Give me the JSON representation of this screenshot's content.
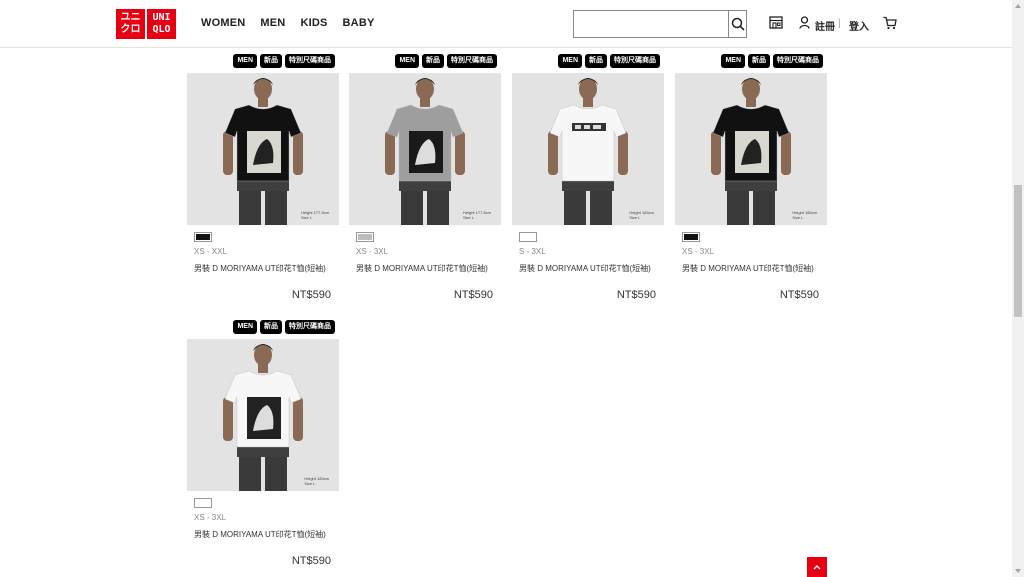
{
  "header": {
    "logo_lines": [
      "ユニ",
      "クロ"
    ],
    "logo_lines_right": [
      "UNI",
      "QLO"
    ],
    "nav": [
      "WOMEN",
      "MEN",
      "KIDS",
      "BABY"
    ],
    "search_value": "",
    "search_placeholder": "",
    "register_label": "註冊",
    "login_label": "登入",
    "separator": "|"
  },
  "products": [
    {
      "badges": [
        "MEN",
        "新品",
        "特別尺碼商品"
      ],
      "shirt_color": "#111111",
      "swatch_color": "#111111",
      "sizes": "XS - XXL",
      "name": "男裝 D MORIYAMA UT印花T恤(短袖)",
      "price": "NT$590",
      "caption": [
        "Height 177.5cm",
        "Size L"
      ],
      "view": "front"
    },
    {
      "badges": [
        "MEN",
        "新品",
        "特別尺碼商品"
      ],
      "shirt_color": "#9e9e9e",
      "swatch_color": "#bdbdbd",
      "sizes": "XS - 3XL",
      "name": "男裝 D MORIYAMA UT印花T恤(短袖)",
      "price": "NT$590",
      "caption": [
        "Height 177.5cm",
        "Size L"
      ],
      "view": "front"
    },
    {
      "badges": [
        "MEN",
        "新品",
        "特別尺碼商品"
      ],
      "shirt_color": "#f7f7f7",
      "swatch_color": "#ffffff",
      "sizes": "S - 3XL",
      "name": "男裝 D MORIYAMA UT印花T恤(短袖)",
      "price": "NT$590",
      "caption": [
        "Height 183cm",
        "Size L"
      ],
      "view": "back"
    },
    {
      "badges": [
        "MEN",
        "新品",
        "特別尺碼商品"
      ],
      "shirt_color": "#111111",
      "swatch_color": "#111111",
      "sizes": "XS - 3XL",
      "name": "男裝 D MORIYAMA UT印花T恤(短袖)",
      "price": "NT$590",
      "caption": [
        "Height 183cm",
        "Size L"
      ],
      "view": "front"
    },
    {
      "badges": [
        "MEN",
        "新品",
        "特別尺碼商品"
      ],
      "shirt_color": "#f7f7f7",
      "swatch_color": "#ffffff",
      "sizes": "XS - 3XL",
      "name": "男裝 D MORIYAMA UT印花T恤(短袖)",
      "price": "NT$590",
      "caption": [
        "Height 183cm",
        "Size L"
      ],
      "view": "front"
    }
  ],
  "colors": {
    "brand_red": "#e60012",
    "photo_bg": "#e3e3e3",
    "badge_bg": "#000000"
  }
}
